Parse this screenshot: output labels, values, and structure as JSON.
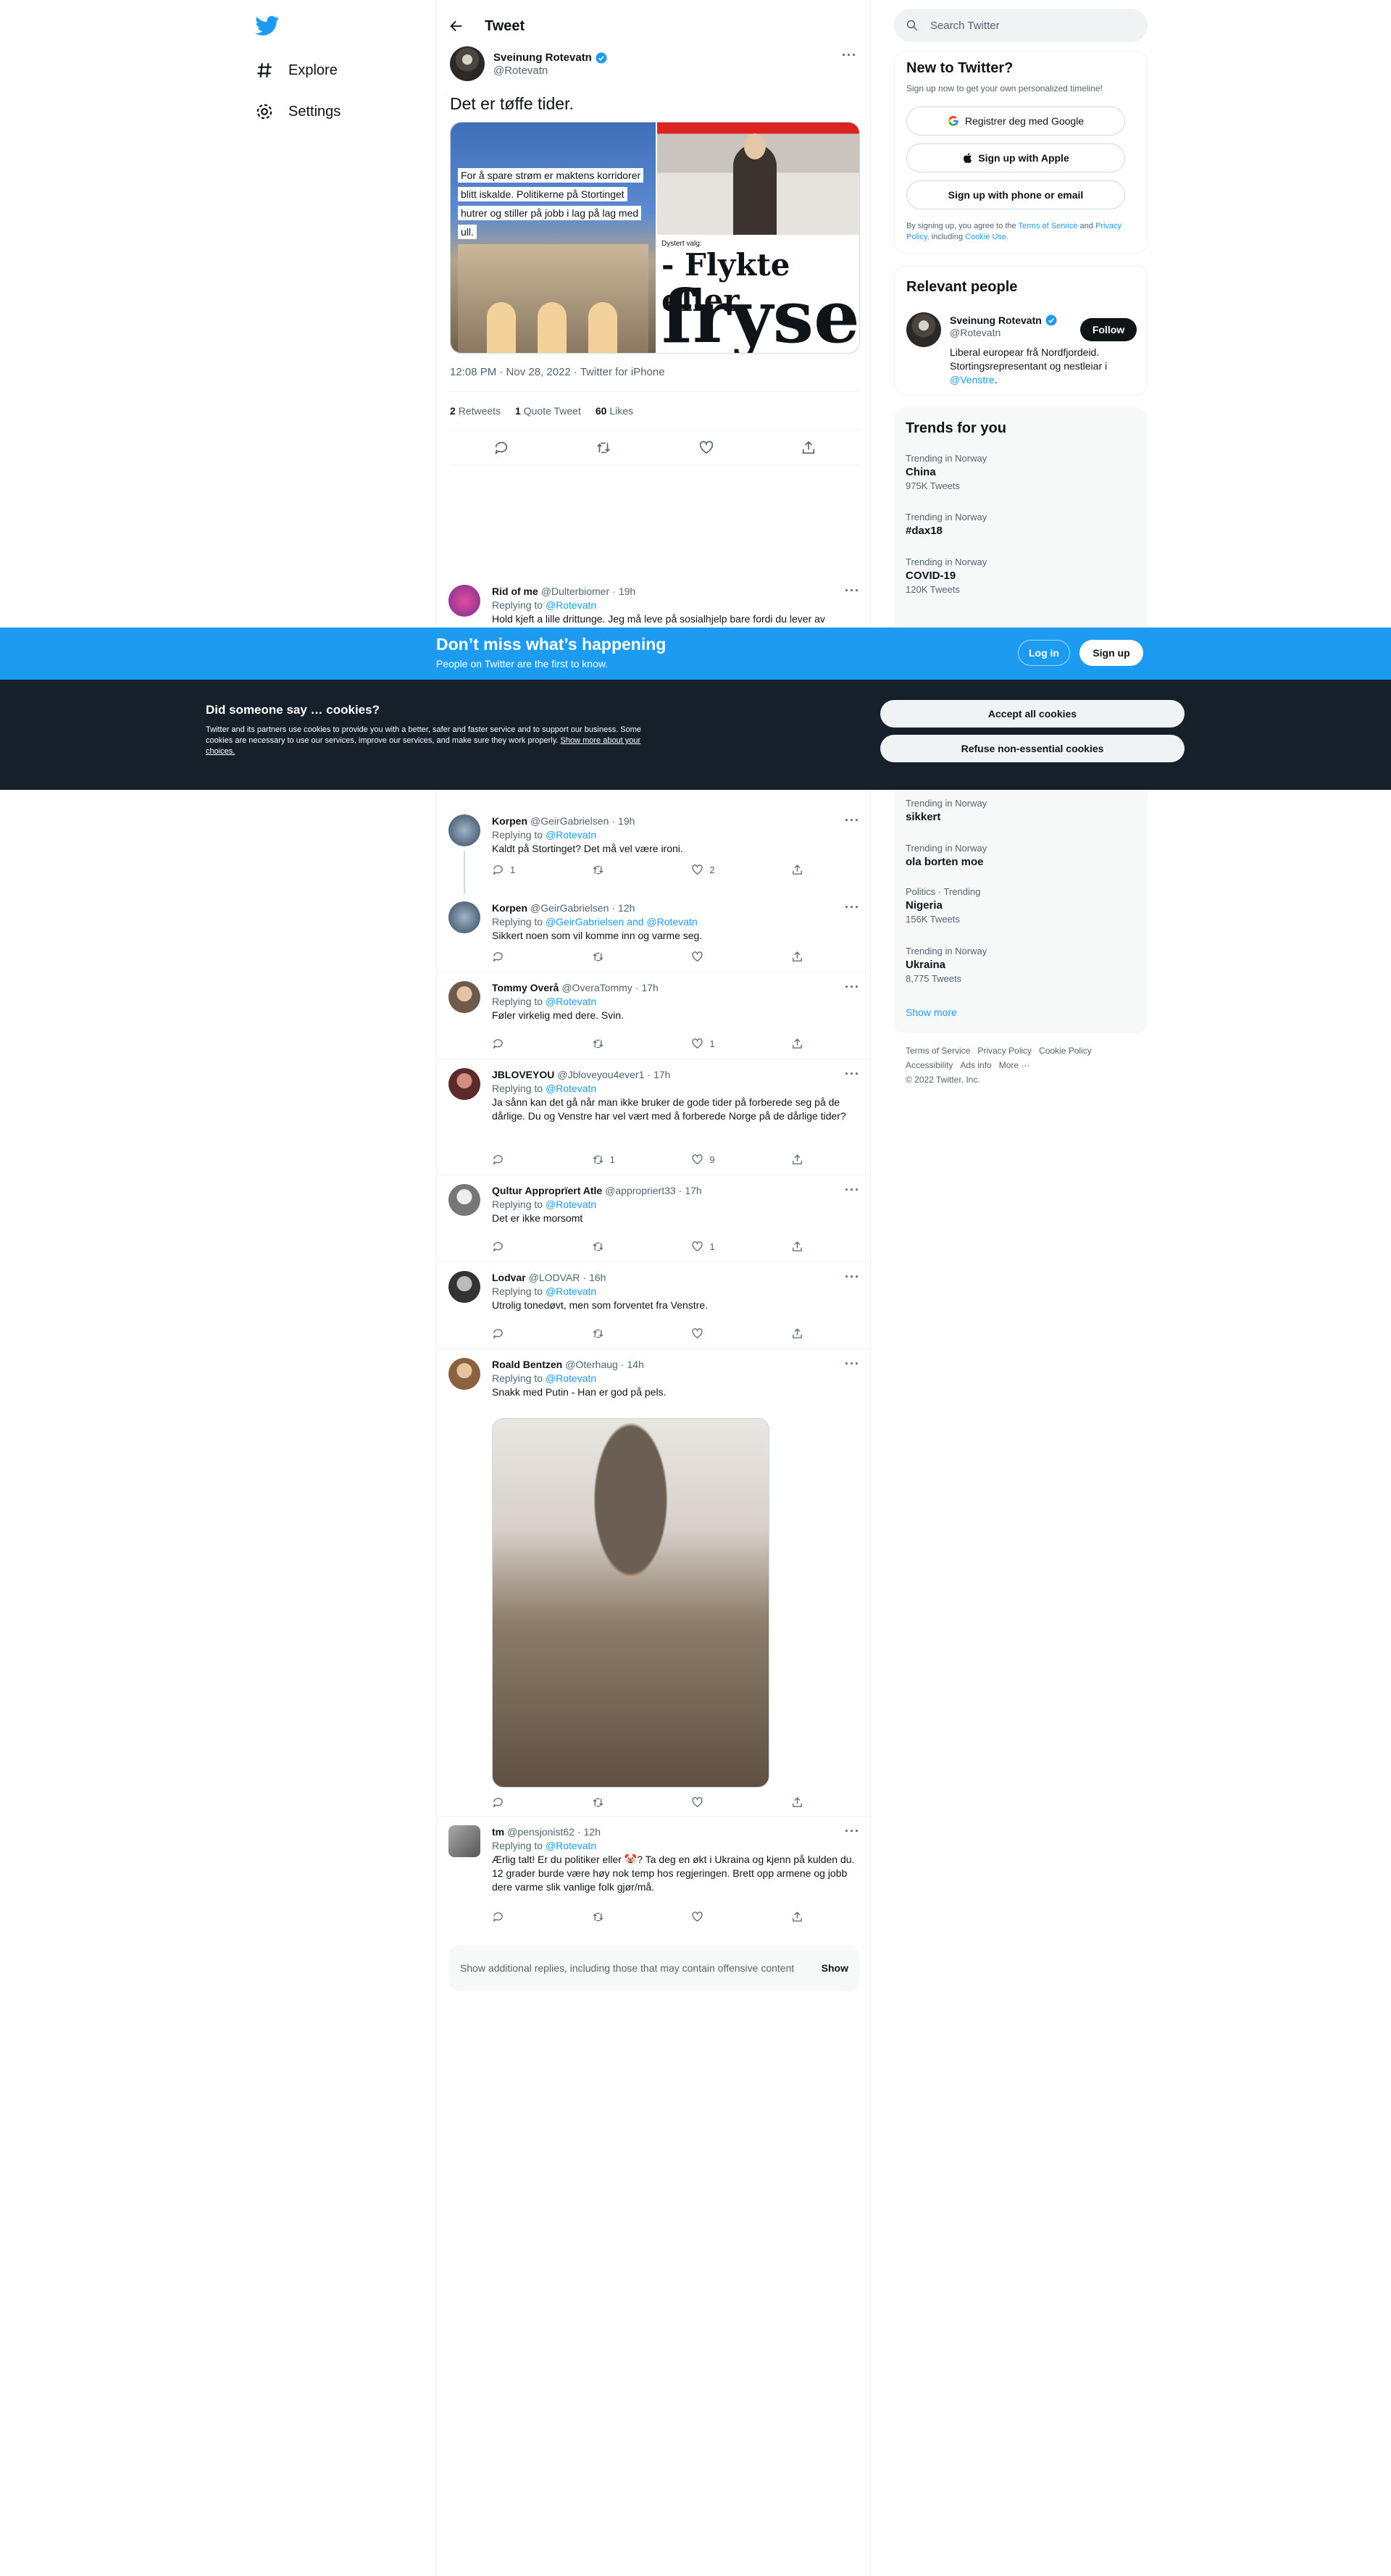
{
  "nav": {
    "items": [
      {
        "label": "Explore"
      },
      {
        "label": "Settings"
      }
    ]
  },
  "header": {
    "title": "Tweet"
  },
  "tweet": {
    "author_name": "Sveinung Rotevatn",
    "author_handle": "@Rotevatn",
    "text": "Det er tøffe tider.",
    "media_caption": "For å spare strøm er maktens korridorer blitt iskalde. Politikerne på Stortinget hutrer og stiller på jobb i lag på lag med ull.",
    "media_kicker": "Dystert valg:",
    "media_headline": "- Flykte eller",
    "media_big": "fryse",
    "meta": "12:08 PM · Nov 28, 2022 · Twitter for iPhone",
    "retweets_count": "2",
    "retweets_label": "Retweets",
    "quotes_count": "1",
    "quotes_label": "Quote Tweet",
    "likes_count": "60",
    "likes_label": "Likes"
  },
  "replies": [
    {
      "name": "Rid of me",
      "handle": "@Dulterbiomer",
      "time": "19h",
      "replying_to": "@Rotevatn",
      "text": "Hold kjeft a lille drittunge. Jeg må leve på sosialhjelp bare fordi du lever av"
    },
    {
      "name": "Korpen",
      "handle": "@GeirGabrielsen",
      "time": "19h",
      "replying_to": "@Rotevatn",
      "text": "Kaldt på Stortinget? Det må vel være ironi.",
      "replies": "1",
      "retweets": "",
      "likes": "2"
    },
    {
      "name": "Korpen",
      "handle": "@GeirGabrielsen",
      "time": "12h",
      "replying_to": "@GeirGabrielsen and @Rotevatn",
      "text": "Sikkert noen som vil komme inn og varme seg.",
      "replies": "",
      "retweets": "",
      "likes": ""
    },
    {
      "name": "Tommy Overå",
      "handle": "@OveraTommy",
      "time": "17h",
      "replying_to": "@Rotevatn",
      "text": "Føler virkelig med dere. Svin.",
      "replies": "",
      "retweets": "",
      "likes": "1"
    },
    {
      "name": "JBLOVEYOU",
      "handle": "@Jbloveyou4ever1",
      "time": "17h",
      "replying_to": "@Rotevatn",
      "text": "Ja sånn kan det gå når man ikke bruker de gode tider på forberede seg på de dårlige. Du og Venstre har vel vært med å forberede Norge på de dårlige tider?",
      "replies": "",
      "retweets": "1",
      "likes": "9"
    },
    {
      "name": "Qultur Approprïert Atle",
      "handle": "@appropriert33",
      "time": "17h",
      "replying_to": "@Rotevatn",
      "text": "Det er ikke morsomt",
      "replies": "",
      "retweets": "",
      "likes": "1"
    },
    {
      "name": "Lodvar",
      "handle": "@LODVAR",
      "time": "16h",
      "replying_to": "@Rotevatn",
      "text": "Utrolig tonedøvt, men som forventet fra Venstre.",
      "replies": "",
      "retweets": "",
      "likes": ""
    },
    {
      "name": "Roald Bentzen",
      "handle": "@Oterhaug",
      "time": "14h",
      "replying_to": "@Rotevatn",
      "text": "Snakk med Putin - Han er god på pels.",
      "replies": "",
      "retweets": "",
      "likes": ""
    },
    {
      "name": "tm",
      "handle": "@pensjonist62",
      "time": "12h",
      "replying_to": "@Rotevatn",
      "text": "Ærlig talt! Er du politiker eller 🤡? Ta deg en økt i Ukraina og kjenn på kulden du. 12 grader burde være høy nok temp hos regjeringen. Brett opp armene og jobb dere varme slik vanlige folk gjør/må.",
      "replies": "",
      "retweets": "",
      "likes": ""
    }
  ],
  "replying_prefix": "Replying to",
  "show_more": {
    "text": "Show additional replies, including those that may contain offensive content",
    "button": "Show"
  },
  "sidebar": {
    "search_placeholder": "Search Twitter",
    "new_title": "New to Twitter?",
    "new_sub": "Sign up now to get your own personalized timeline!",
    "google_btn": "Registrer deg med Google",
    "apple_btn": "Sign up with Apple",
    "phone_btn": "Sign up with phone or email",
    "terms_pre": "By signing up, you agree to the",
    "terms_tos": "Terms of Service",
    "terms_and": "and",
    "terms_privacy": "Privacy Policy",
    "terms_incl": ", including",
    "terms_cookie": "Cookie Use.",
    "relevant_title": "Relevant people",
    "person_name": "Sveinung Rotevatn",
    "person_handle": "@Rotevatn",
    "follow_btn": "Follow",
    "person_bio": "Liberal europear frå Nordfjordeid. Stortingsrepresentant og nestleiar i",
    "person_bio_link": "@Venstre",
    "trends_title": "Trends for you",
    "trends": [
      {
        "context": "Trending in Norway",
        "name": "China",
        "count": "975K Tweets"
      },
      {
        "context": "Trending in Norway",
        "name": "#dax18",
        "count": ""
      },
      {
        "context": "Trending in Norway",
        "name": "COVID-19",
        "count": "120K Tweets"
      },
      {
        "context": "Trending in Norway",
        "name": "sikkert",
        "count": ""
      },
      {
        "context": "Trending in Norway",
        "name": "ola borten moe",
        "count": ""
      },
      {
        "context": "Politics · Trending",
        "name": "Nigeria",
        "count": "156K Tweets"
      },
      {
        "context": "Trending in Norway",
        "name": "Ukraina",
        "count": "8,775 Tweets"
      }
    ],
    "show_more": "Show more",
    "footer": [
      "Terms of Service",
      "Privacy Policy",
      "Cookie Policy",
      "Accessibility",
      "Ads info",
      "More ···",
      "© 2022 Twitter, Inc."
    ]
  },
  "banner": {
    "headline": "Don’t miss what’s happening",
    "sub": "People on Twitter are the first to know.",
    "login": "Log in",
    "signup": "Sign up"
  },
  "cookies": {
    "title": "Did someone say … cookies?",
    "text": "Twitter and its partners use cookies to provide you with a better, safer and faster service and to support our business. Some cookies are necessary to use our services, improve our services, and make sure they work properly.",
    "link": "Show more about your choices.",
    "accept": "Accept all cookies",
    "refuse": "Refuse non-essential cookies"
  },
  "colors": {
    "accent": "#1d9bf0",
    "dark": "#15202b",
    "text": "#0f1419",
    "muted": "#536471"
  }
}
